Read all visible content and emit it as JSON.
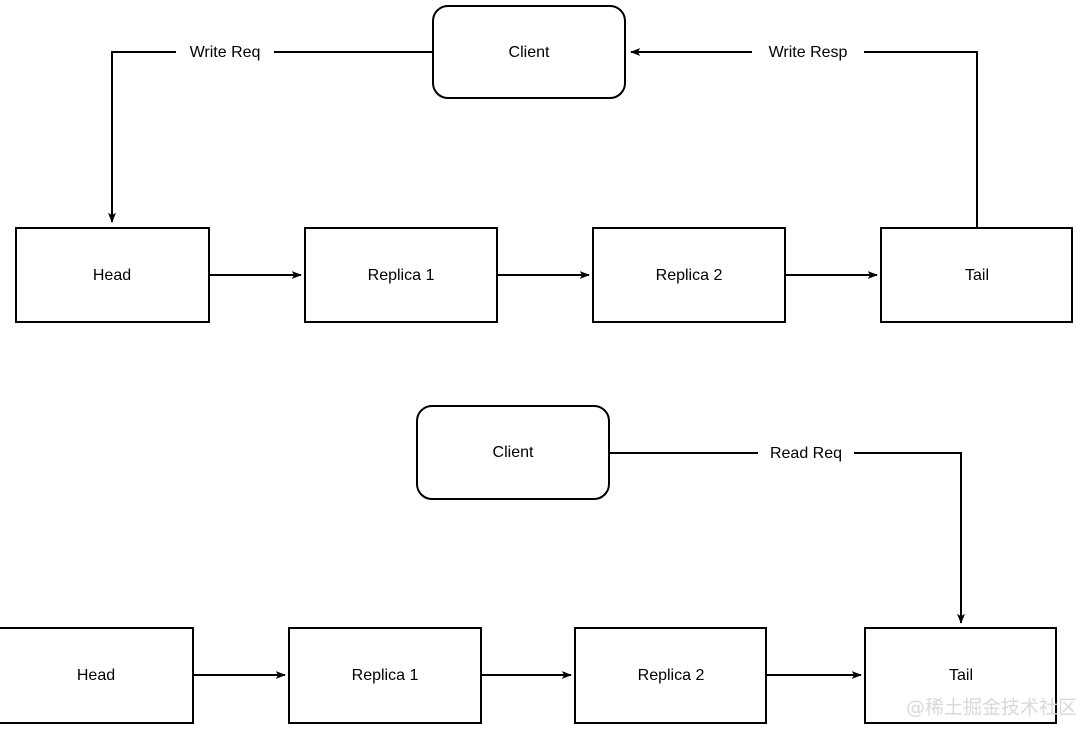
{
  "diagram": {
    "title_visible": false,
    "background_color": "#ffffff",
    "stroke_color": "#000000",
    "fill_color": "#ffffff",
    "watermark": {
      "text": "@稀土掘金技术社区",
      "color": "#d9d9d9"
    },
    "sections": [
      {
        "id": "write-path",
        "nodes": [
          {
            "id": "client-top",
            "label": "Client",
            "shape": "rounded-rect"
          },
          {
            "id": "head-top",
            "label": "Head",
            "shape": "rect"
          },
          {
            "id": "replica1-top",
            "label": "Replica 1",
            "shape": "rect"
          },
          {
            "id": "replica2-top",
            "label": "Replica 2",
            "shape": "rect"
          },
          {
            "id": "tail-top",
            "label": "Tail",
            "shape": "rect"
          }
        ],
        "edges": [
          {
            "id": "write-req",
            "label": "Write Req",
            "from": "client-top",
            "to": "head-top",
            "arrow": true
          },
          {
            "id": "chain-head-r1-top",
            "label": "",
            "from": "head-top",
            "to": "replica1-top",
            "arrow": true
          },
          {
            "id": "chain-r1-r2-top",
            "label": "",
            "from": "replica1-top",
            "to": "replica2-top",
            "arrow": true
          },
          {
            "id": "chain-r2-tail-top",
            "label": "",
            "from": "replica2-top",
            "to": "tail-top",
            "arrow": true
          },
          {
            "id": "write-resp",
            "label": "Write Resp",
            "from": "tail-top",
            "to": "client-top",
            "arrow": true
          }
        ]
      },
      {
        "id": "read-path",
        "nodes": [
          {
            "id": "client-bottom",
            "label": "Client",
            "shape": "rounded-rect"
          },
          {
            "id": "head-bottom",
            "label": "Head",
            "shape": "rect"
          },
          {
            "id": "replica1-bottom",
            "label": "Replica 1",
            "shape": "rect"
          },
          {
            "id": "replica2-bottom",
            "label": "Replica 2",
            "shape": "rect"
          },
          {
            "id": "tail-bottom",
            "label": "Tail",
            "shape": "rect"
          }
        ],
        "edges": [
          {
            "id": "read-req",
            "label": "Read Req",
            "from": "client-bottom",
            "to": "tail-bottom",
            "arrow": true
          },
          {
            "id": "chain-head-r1-bottom",
            "label": "",
            "from": "head-bottom",
            "to": "replica1-bottom",
            "arrow": true
          },
          {
            "id": "chain-r1-r2-bottom",
            "label": "",
            "from": "replica1-bottom",
            "to": "replica2-bottom",
            "arrow": true
          },
          {
            "id": "chain-r2-tail-bottom",
            "label": "",
            "from": "replica2-bottom",
            "to": "tail-bottom",
            "arrow": true
          }
        ]
      }
    ],
    "labels": {
      "client": "Client",
      "head": "Head",
      "replica1": "Replica 1",
      "replica2": "Replica 2",
      "tail": "Tail",
      "write_req": "Write Req",
      "write_resp": "Write Resp",
      "read_req": "Read Req"
    }
  }
}
